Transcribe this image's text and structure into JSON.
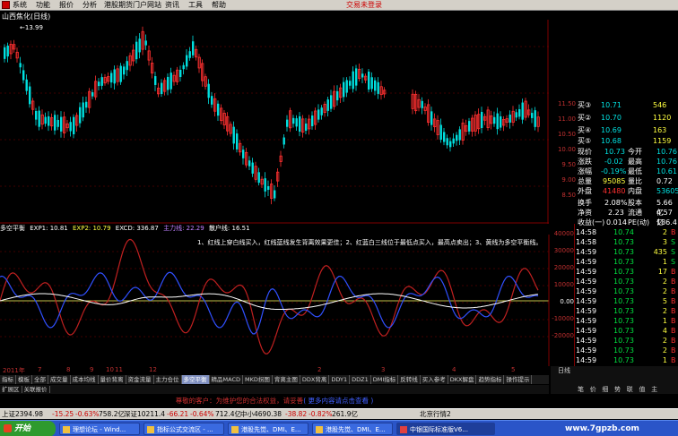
{
  "menu": {
    "items": [
      "系统",
      "功能",
      "报价",
      "分析",
      "港股期货",
      "门户网站",
      "资讯",
      "工具",
      "帮助"
    ],
    "trade": "交易未登录"
  },
  "chart": {
    "title": "山西焦化(日线)",
    "high_label": "13.99",
    "price_axis": [
      "11.50",
      "11.00",
      "10.50",
      "10.00",
      "9.50",
      "9.00",
      "8.50"
    ],
    "osc_axis": [
      "40000",
      "30000",
      "20000",
      "10000",
      "0.00",
      "-10000",
      "-20000"
    ]
  },
  "indicator": {
    "name": "多空平衡",
    "exp1": "EXP1: 10.81",
    "exp2": "EXP2: 10.79",
    "excd": "EXCD: 336.87",
    "main": "主力线: 22.29",
    "retail": "散户线: 16.51",
    "annotation": "1、红线上穿白线买入，红线蓝线发生背离效果更佳；2、红蓝白三线位于最低点买入，最高点卖出；3、黄线为多空平衡线。"
  },
  "dates": [
    "2011年",
    "7",
    "8",
    "9",
    "10",
    "11",
    "12",
    "2",
    "3",
    "4",
    "5"
  ],
  "tabs": [
    "指标",
    "模板",
    "全部",
    "成交量",
    "成本均线",
    "量价背离",
    "资金流量",
    "主力仓位",
    "多空平衡",
    "精品MACD",
    "MKD拐图",
    "背离主图",
    "DDX背离",
    "DDY1",
    "DDZ1",
    "DMI指标",
    "反转线",
    "买入参考",
    "DKX解盘",
    "趋势指标",
    "操作提示"
  ],
  "tabs_active": "多空平衡",
  "tabs2": [
    "扩展区",
    "关联报价"
  ],
  "quote": {
    "rows": [
      {
        "lbl": "买③",
        "val": "10.71",
        "v2": "546"
      },
      {
        "lbl": "买②",
        "val": "10.70",
        "v2": "1120"
      },
      {
        "lbl": "买④",
        "val": "10.69",
        "v2": "163"
      },
      {
        "lbl": "买⑤",
        "val": "10.68",
        "v2": "1159"
      }
    ],
    "stats": [
      {
        "l1": "现价",
        "v1": "10.73",
        "l2": "今开",
        "v2": "10.76"
      },
      {
        "l1": "涨跌",
        "v1": "-0.02",
        "l2": "最高",
        "v2": "10.76"
      },
      {
        "l1": "涨幅",
        "v1": "-0.19%",
        "l2": "最低",
        "v2": "10.61"
      },
      {
        "l1": "总量",
        "v1": "95085",
        "l2": "量比",
        "v2": "0.72"
      },
      {
        "l1": "外盘",
        "v1": "41480",
        "l2": "内盘",
        "v2": "53605"
      },
      {
        "l1": "换手",
        "v1": "2.08%",
        "l2": "股本",
        "v2": "5.66亿"
      },
      {
        "l1": "净资",
        "v1": "2.23",
        "l2": "流通",
        "v2": "4.57亿"
      },
      {
        "l1": "收益(一)",
        "v1": "0.014",
        "l2": "PE(动)",
        "v2": "186.4"
      }
    ],
    "ticks": [
      {
        "t": "14:58",
        "p": "10.74",
        "v": "2",
        "s": "B"
      },
      {
        "t": "14:58",
        "p": "10.73",
        "v": "3",
        "s": "S"
      },
      {
        "t": "14:59",
        "p": "10.73",
        "v": "435",
        "s": "S"
      },
      {
        "t": "14:59",
        "p": "10.73",
        "v": "1",
        "s": "S"
      },
      {
        "t": "14:59",
        "p": "10.73",
        "v": "17",
        "s": "B"
      },
      {
        "t": "14:59",
        "p": "10.73",
        "v": "2",
        "s": "B"
      },
      {
        "t": "14:59",
        "p": "10.73",
        "v": "2",
        "s": "B"
      },
      {
        "t": "14:59",
        "p": "10.73",
        "v": "5",
        "s": "B"
      },
      {
        "t": "14:59",
        "p": "10.73",
        "v": "2",
        "s": "B"
      },
      {
        "t": "14:59",
        "p": "10.73",
        "v": "1",
        "s": "B"
      },
      {
        "t": "14:59",
        "p": "10.73",
        "v": "4",
        "s": "B"
      },
      {
        "t": "14:59",
        "p": "10.73",
        "v": "2",
        "s": "B"
      },
      {
        "t": "14:59",
        "p": "10.73",
        "v": "2",
        "s": "B"
      },
      {
        "t": "14:59",
        "p": "10.73",
        "v": "1",
        "s": "B"
      }
    ],
    "bottom_label": "日线",
    "bottom_tabs": [
      "笔",
      "价",
      "细",
      "势",
      "联",
      "值",
      "主"
    ]
  },
  "notice": {
    "text": "尊敬的客户：为维护您的合法权益，请妥善",
    "link": "( 更多内容请点击查看 )"
  },
  "status": {
    "sh": "上证2394.98",
    "sh_chg": "-15.25",
    "sh_pct": "-0.63%",
    "sh_amt": "758.2亿",
    "sz": "深证10211.4",
    "sz_chg": "-66.21",
    "sz_pct": "-0.64%",
    "sz_amt": "712.4亿",
    "zx": "中小4690.38",
    "zx_chg": "-38.82",
    "zx_pct": "-0.82%",
    "zx_amt": "261.9亿",
    "bj": "北京行情2"
  },
  "taskbar": {
    "start": "开始",
    "tasks": [
      "理想论坛 - Wind...",
      "指标公式交流区 - ...",
      "港股先觉、DMI、E...",
      "港股先觉、DMI、E...",
      "中银国际标准版V6..."
    ]
  },
  "watermark": "www.7gpzb.com",
  "colors": {
    "up": "#ff3030",
    "down": "#00e0e0",
    "main": "#c02020",
    "retail": "#3050ff",
    "balance": "#ffffff"
  }
}
